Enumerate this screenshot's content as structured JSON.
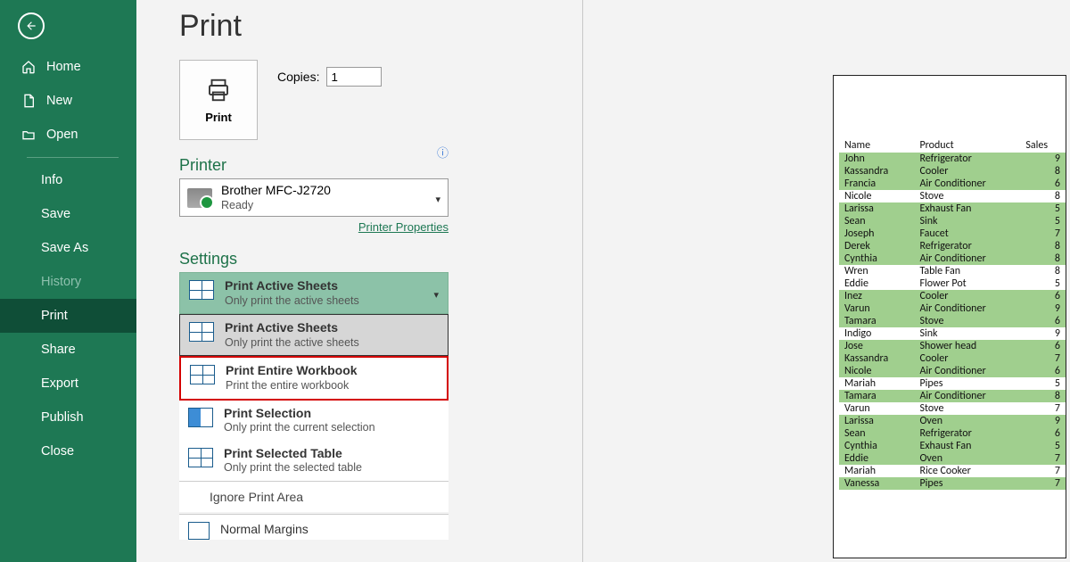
{
  "title": "Print",
  "sidebar": {
    "items": [
      "Home",
      "New",
      "Open",
      "Info",
      "Save",
      "Save As",
      "History",
      "Print",
      "Share",
      "Export",
      "Publish",
      "Close"
    ]
  },
  "printBtn": {
    "label": "Print"
  },
  "copies": {
    "label": "Copies:",
    "value": "1"
  },
  "printer": {
    "heading": "Printer",
    "name": "Brother MFC-J2720",
    "status": "Ready",
    "propsLink": "Printer Properties"
  },
  "settings": {
    "heading": "Settings",
    "selected": {
      "title": "Print Active Sheets",
      "sub": "Only print the active sheets"
    },
    "options": [
      {
        "title": "Print Active Sheets",
        "sub": "Only print the active sheets"
      },
      {
        "title": "Print Entire Workbook",
        "sub": "Print the entire workbook"
      },
      {
        "title": "Print Selection",
        "sub": "Only print the current selection"
      },
      {
        "title": "Print Selected Table",
        "sub": "Only print the selected table"
      }
    ],
    "ignore": "Ignore Print Area",
    "margins": "Normal Margins"
  },
  "preview": {
    "headers": [
      "Name",
      "Product",
      "Sales"
    ],
    "rows": [
      {
        "n": "John",
        "p": "Refrigerator",
        "s": "9",
        "b": 1
      },
      {
        "n": "Kassandra",
        "p": "Cooler",
        "s": "8",
        "b": 1
      },
      {
        "n": "Francia",
        "p": "Air Conditioner",
        "s": "6",
        "b": 1
      },
      {
        "n": "Nicole",
        "p": "Stove",
        "s": "8",
        "b": 0
      },
      {
        "n": "Larissa",
        "p": "Exhaust Fan",
        "s": "5",
        "b": 1
      },
      {
        "n": "Sean",
        "p": "Sink",
        "s": "5",
        "b": 1
      },
      {
        "n": "Joseph",
        "p": "Faucet",
        "s": "7",
        "b": 1
      },
      {
        "n": "Derek",
        "p": "Refrigerator",
        "s": "8",
        "b": 1
      },
      {
        "n": "Cynthia",
        "p": "Air Conditioner",
        "s": "8",
        "b": 1
      },
      {
        "n": "Wren",
        "p": "Table Fan",
        "s": "8",
        "b": 0
      },
      {
        "n": "Eddie",
        "p": "Flower Pot",
        "s": "5",
        "b": 0
      },
      {
        "n": "Inez",
        "p": "Cooler",
        "s": "6",
        "b": 1
      },
      {
        "n": "Varun",
        "p": "Air Conditioner",
        "s": "9",
        "b": 1
      },
      {
        "n": "Tamara",
        "p": "Stove",
        "s": "6",
        "b": 1
      },
      {
        "n": "Indigo",
        "p": "Sink",
        "s": "9",
        "b": 0
      },
      {
        "n": "Jose",
        "p": "Shower head",
        "s": "6",
        "b": 1
      },
      {
        "n": "Kassandra",
        "p": "Cooler",
        "s": "7",
        "b": 1
      },
      {
        "n": "Nicole",
        "p": "Air Conditioner",
        "s": "6",
        "b": 1
      },
      {
        "n": "Mariah",
        "p": "Pipes",
        "s": "5",
        "b": 0
      },
      {
        "n": "Tamara",
        "p": "Air Conditioner",
        "s": "8",
        "b": 1
      },
      {
        "n": "Varun",
        "p": "Stove",
        "s": "7",
        "b": 0
      },
      {
        "n": "Larissa",
        "p": "Oven",
        "s": "9",
        "b": 1
      },
      {
        "n": "Sean",
        "p": "Refrigerator",
        "s": "6",
        "b": 1
      },
      {
        "n": "Cynthia",
        "p": "Exhaust Fan",
        "s": "5",
        "b": 1
      },
      {
        "n": "Eddie",
        "p": "Oven",
        "s": "7",
        "b": 1
      },
      {
        "n": "Mariah",
        "p": "Rice Cooker",
        "s": "7",
        "b": 0
      },
      {
        "n": "Vanessa",
        "p": "Pipes",
        "s": "7",
        "b": 1
      }
    ]
  }
}
